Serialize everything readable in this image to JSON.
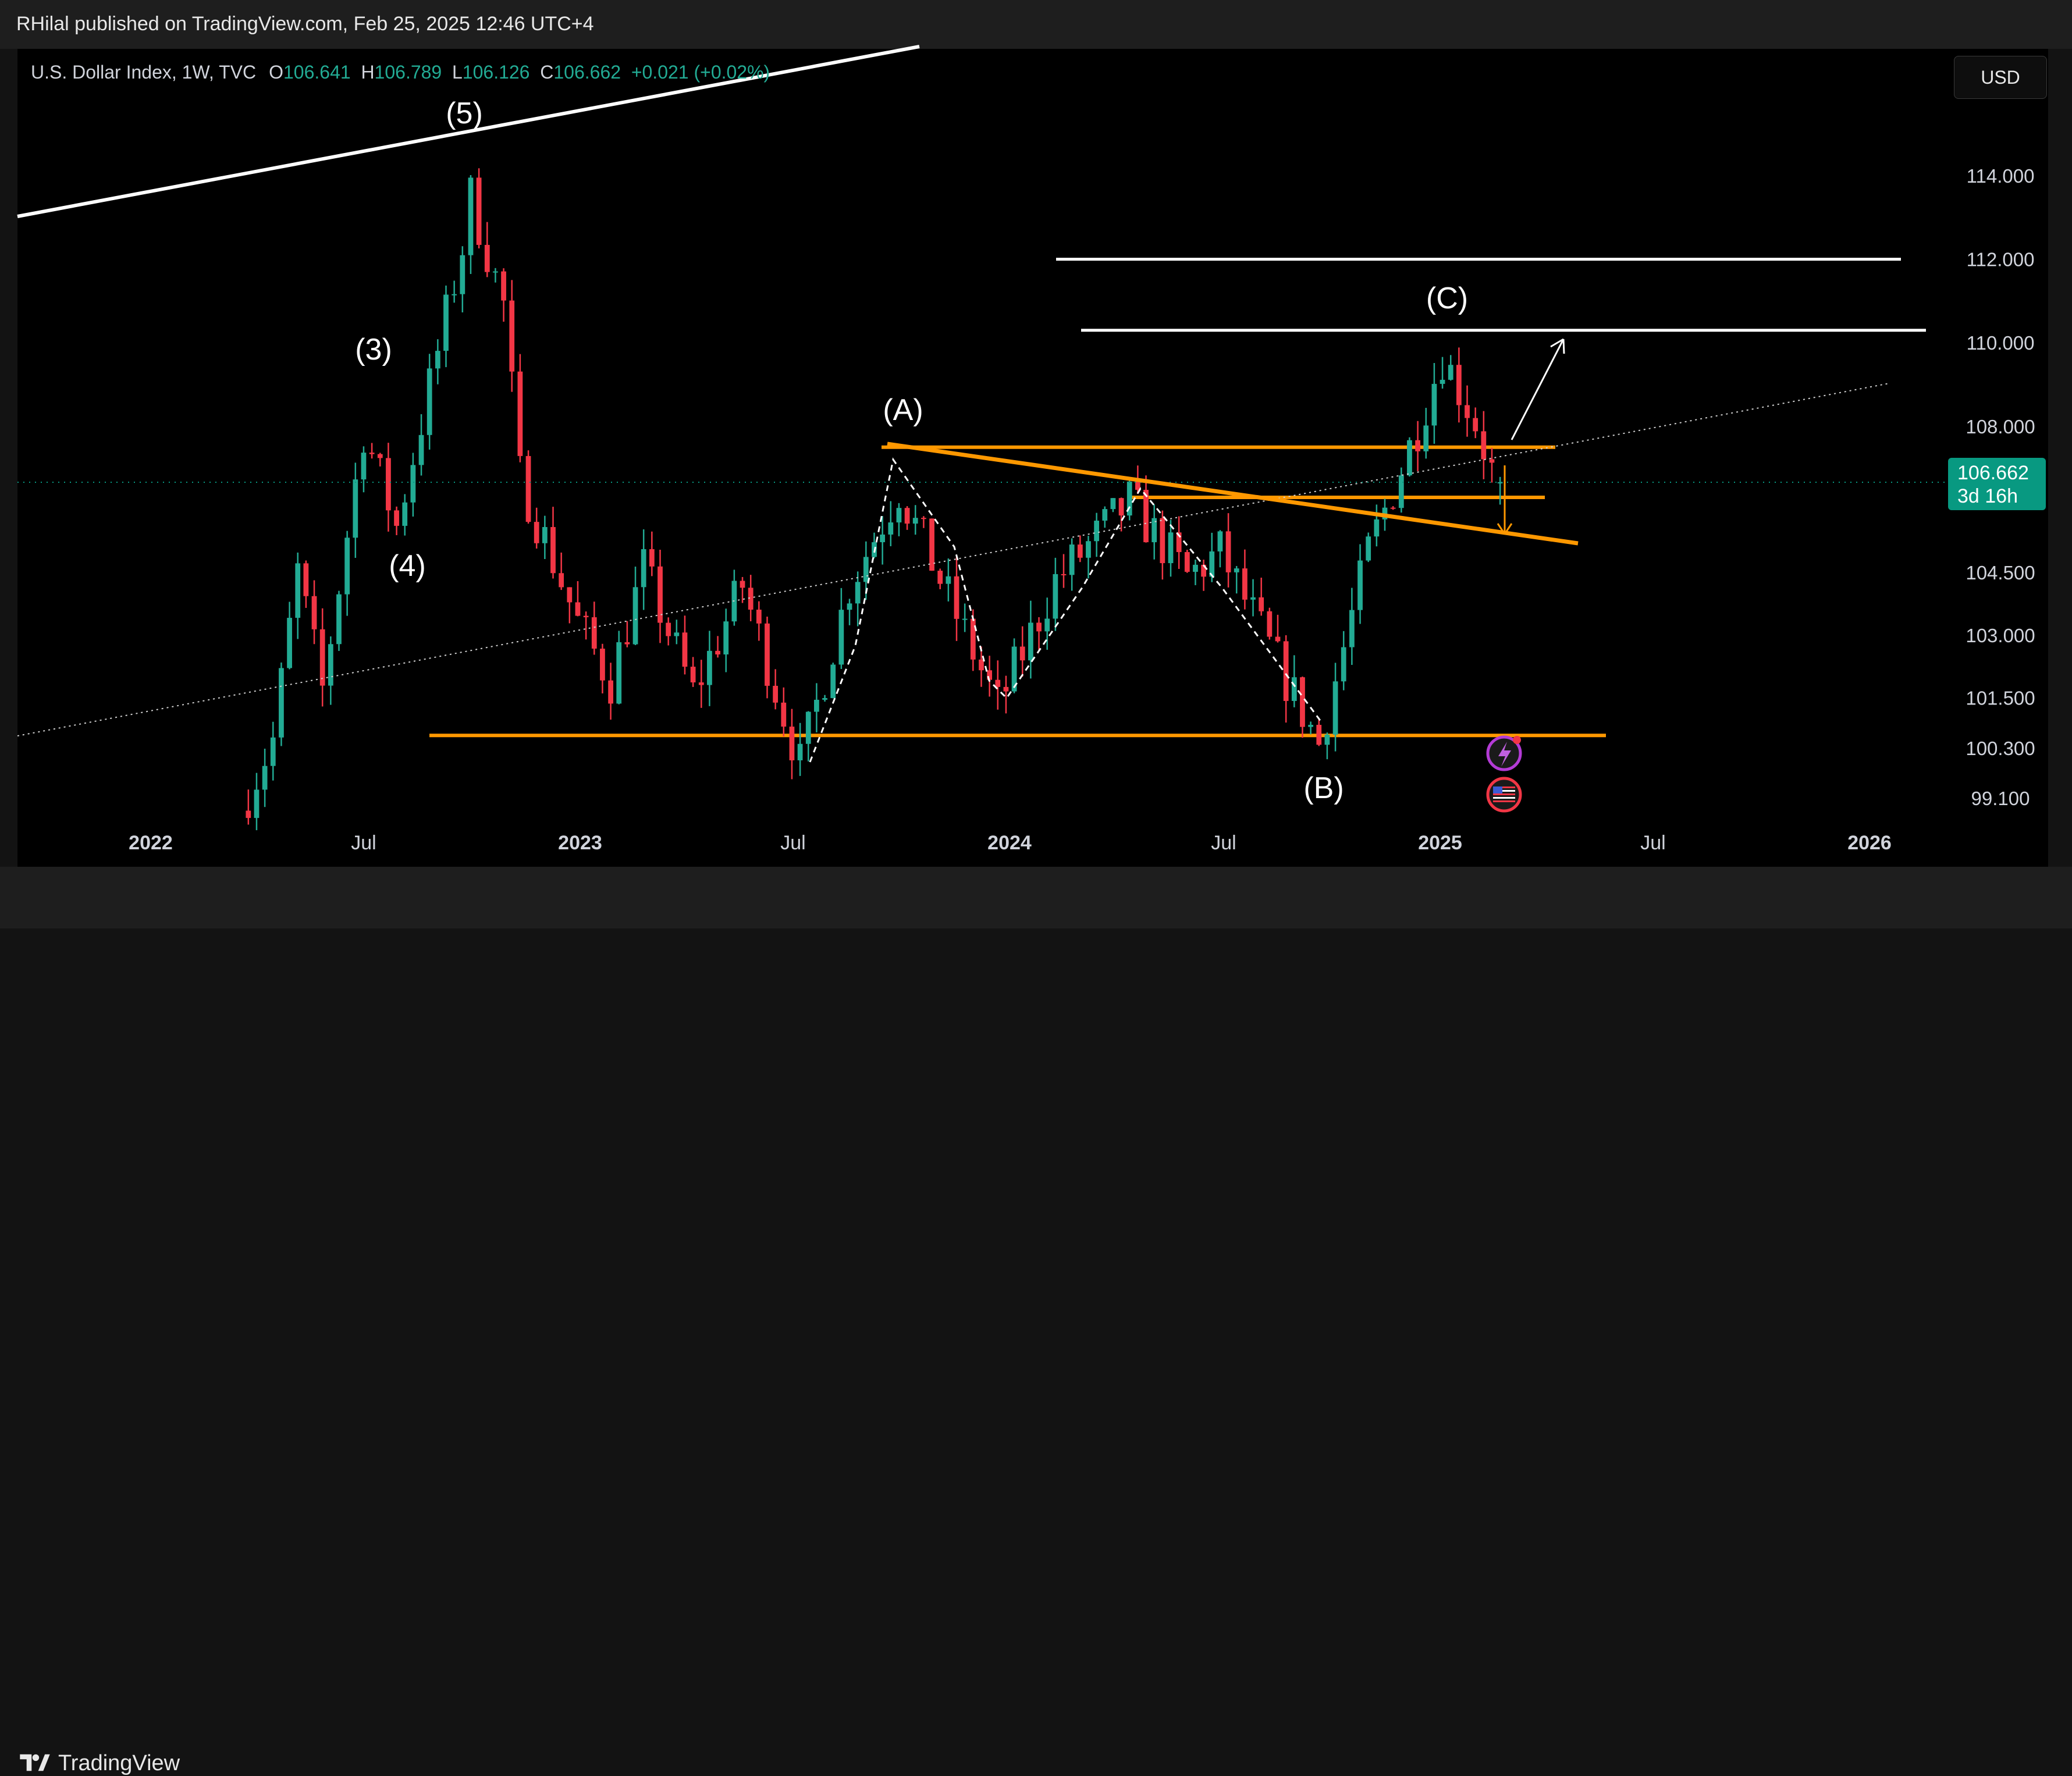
{
  "header": {
    "publisher_text": "RHilal published on TradingView.com, Feb 25, 2025 12:46 UTC+4"
  },
  "legend": {
    "symbol": "U.S. Dollar Index, 1W, TVC",
    "open_label": "O",
    "open": "106.641",
    "high_label": "H",
    "high": "106.789",
    "low_label": "L",
    "low": "106.126",
    "close_label": "C",
    "close": "106.662",
    "change": "+0.021 (+0.02%)"
  },
  "currency_button": "USD",
  "price_badge": {
    "price": "106.662",
    "countdown": "3d 16h"
  },
  "footer": {
    "brand": "TradingView"
  },
  "colors": {
    "up": "#22ab94",
    "down": "#f23645",
    "support": "#ff9800",
    "background": "#000000",
    "accent_badge": "#089981"
  },
  "chart_data": {
    "type": "candlestick",
    "title": "U.S. Dollar Index, 1W, TVC",
    "y_ticks": [
      "114.000",
      "112.000",
      "110.000",
      "108.000",
      "104.500",
      "103.000",
      "101.500",
      "100.300",
      "99.100"
    ],
    "y_tick_values": [
      114,
      112,
      110,
      108,
      104.5,
      103,
      101.5,
      100.3,
      99.1
    ],
    "x_ticks": [
      "2022",
      "Jul",
      "2023",
      "Jul",
      "2024",
      "Jul",
      "2025",
      "Jul",
      "2026"
    ],
    "x_tick_dates": [
      "2022-01-01",
      "2022-07-01",
      "2023-01-01",
      "2023-07-01",
      "2024-01-01",
      "2024-07-01",
      "2025-01-01",
      "2025-07-01",
      "2026-01-01"
    ],
    "ylim": [
      98.6,
      117
    ],
    "current_price": 106.662,
    "ohlc": {
      "open": 106.641,
      "high": 106.789,
      "low": 106.126,
      "close": 106.662
    },
    "price_path": [
      [
        "2022-03-25",
        98.8
      ],
      [
        "2022-04-22",
        100.5
      ],
      [
        "2022-05-13",
        104.5
      ],
      [
        "2022-06-03",
        101.7
      ],
      [
        "2022-07-08",
        107.9
      ],
      [
        "2022-08-05",
        105.6
      ],
      [
        "2022-09-30",
        112.3
      ],
      [
        "2022-10-07",
        113.5
      ],
      [
        "2022-11-04",
        110.9
      ],
      [
        "2022-11-18",
        106.8
      ],
      [
        "2023-01-06",
        103.3
      ],
      [
        "2023-02-03",
        101.9
      ],
      [
        "2023-03-03",
        104.6
      ],
      [
        "2023-04-14",
        101.6
      ],
      [
        "2023-05-26",
        104.2
      ],
      [
        "2023-07-14",
        99.9
      ],
      [
        "2023-08-25",
        104.2
      ],
      [
        "2023-10-06",
        106.5
      ],
      [
        "2023-12-29",
        101.3
      ],
      [
        "2024-02-16",
        104.3
      ],
      [
        "2024-04-19",
        106.2
      ],
      [
        "2024-06-07",
        104.4
      ],
      [
        "2024-07-05",
        105.0
      ],
      [
        "2024-09-27",
        100.4
      ],
      [
        "2024-11-08",
        105.0
      ],
      [
        "2024-12-20",
        108.0
      ],
      [
        "2025-01-10",
        109.7
      ],
      [
        "2025-02-07",
        108.1
      ],
      [
        "2025-02-24",
        106.662
      ]
    ],
    "wave_labels": [
      "(3)",
      "(4)",
      "(5)",
      "(A)",
      "(B)",
      "(C)"
    ],
    "horizontal_levels": [
      {
        "price": 112.0,
        "color": "white"
      },
      {
        "price": 110.3,
        "color": "white"
      },
      {
        "price": 107.5,
        "color": "orange"
      },
      {
        "price": 106.3,
        "color": "orange"
      },
      {
        "price": 100.6,
        "color": "orange"
      }
    ],
    "grid": false,
    "legend": "top-left"
  }
}
